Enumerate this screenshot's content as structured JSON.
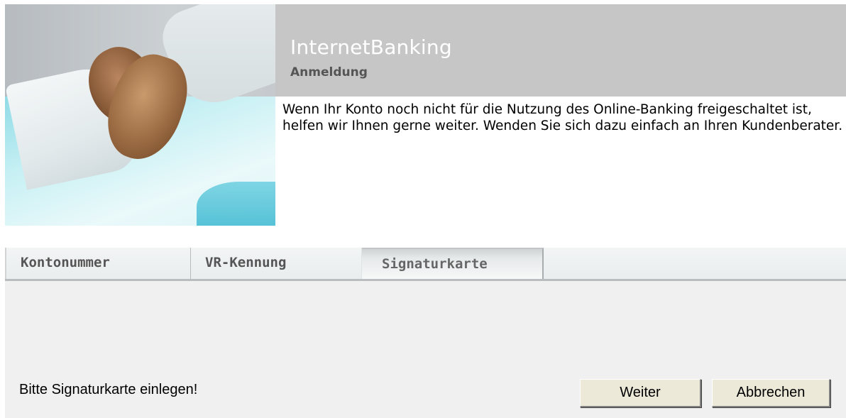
{
  "header": {
    "title": "InternetBanking",
    "subtitle": "Anmeldung"
  },
  "hero": {
    "image": "handshake-photo"
  },
  "intro": {
    "text": "Wenn Ihr Konto noch nicht für die Nutzung des Online-Banking freigeschaltet ist, helfen wir Ihnen gerne weiter. Wenden Sie sich dazu einfach an Ihren Kundenberater."
  },
  "tabs": [
    {
      "label": "Kontonummer",
      "active": false
    },
    {
      "label": "VR-Kennung",
      "active": false
    },
    {
      "label": "Signaturkarte",
      "active": true
    }
  ],
  "panel": {
    "message": "Bitte Signaturkarte einlegen!",
    "buttons": {
      "next_label": "Weiter",
      "cancel_label": "Abbrechen"
    }
  },
  "colors": {
    "header_band": "#c6c6c6",
    "title_text": "#ffffff",
    "subtitle_text": "#555555",
    "panel_background": "#f0f0f0",
    "button_face": "#ece9d8"
  }
}
